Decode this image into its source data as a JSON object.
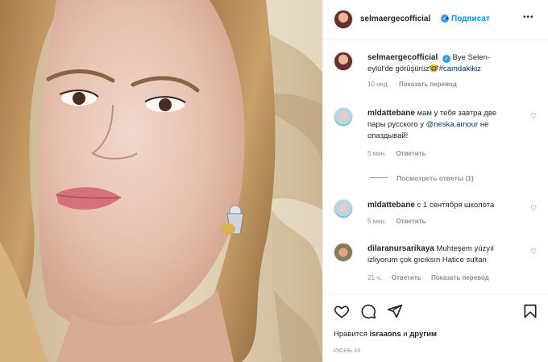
{
  "post": {
    "username": "selmaergecofficial",
    "follow_label": "Подписат",
    "more_label": "•••"
  },
  "caption": {
    "username": "selmaergecofficial",
    "text_part1": "Bye Selen-",
    "text_part2": "eylül'de görüşürüz",
    "emoji": "🤓",
    "hashtag": "#camdakikiz",
    "time": "10 нед.",
    "translate": "Показать перевод"
  },
  "comments": [
    {
      "username": "mldattebane",
      "line1": "мам у тебя завтра две",
      "line2_pre": "пары русского у ",
      "mention": "@neska.amour",
      "line2_post": " не",
      "line3": "опаздывай!",
      "time": "5 мин.",
      "reply": "Ответить"
    },
    {
      "view_replies": "Посмотреть ответы (1)"
    },
    {
      "username": "mldattebane",
      "text": "с 1 сентября школота",
      "time": "5 мин.",
      "reply": "Ответить"
    },
    {
      "username": "dilaranursarikaya",
      "line1": "Muhteşem yüzyıl",
      "line2": "izliyorum çok gıcıksın Hatice sultan",
      "time": "21 ч.",
      "reply": "Ответить",
      "translate": "Показать перевод"
    }
  ],
  "likes": {
    "prefix": "Нравится ",
    "user": "israaons",
    "middle": " и ",
    "others": "другим"
  },
  "date": "ИЮНЬ 16",
  "icons": [
    "heart-icon",
    "comment-icon",
    "share-icon",
    "bookmark-icon",
    "verified-badge-icon",
    "more-icon"
  ],
  "colors": {
    "link": "#00376b",
    "verified": "#3897f0",
    "follow": "#0095f6",
    "meta": "#8e8e8e"
  }
}
